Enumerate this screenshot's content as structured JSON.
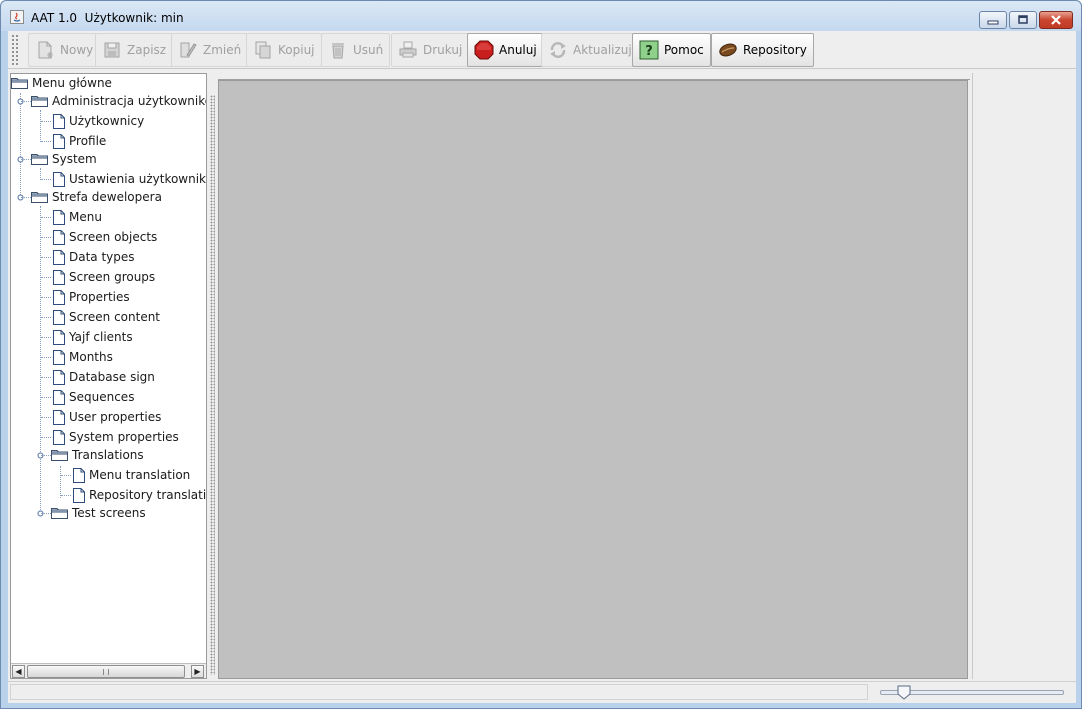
{
  "window": {
    "title": "AAT 1.0  Użytkownik: min",
    "controls": [
      "minimize",
      "maximize",
      "close"
    ]
  },
  "toolbar": {
    "buttons": [
      {
        "label": "Nowy",
        "icon": "new-document-icon",
        "enabled": false
      },
      {
        "label": "Zapisz",
        "icon": "save-floppy-icon",
        "enabled": false
      },
      {
        "label": "Zmień",
        "icon": "edit-pencil-icon",
        "enabled": false
      },
      {
        "label": "Kopiuj",
        "icon": "copy-icon",
        "enabled": false
      },
      {
        "label": "Usuń",
        "icon": "trash-icon",
        "enabled": false
      },
      {
        "label": "Drukuj",
        "icon": "printer-icon",
        "enabled": false
      },
      {
        "label": "Anuluj",
        "icon": "stop-sign-icon",
        "enabled": true
      },
      {
        "label": "Aktualizuj",
        "icon": "refresh-icon",
        "enabled": false
      },
      {
        "label": "Pomoc",
        "icon": "help-question-icon",
        "enabled": true
      },
      {
        "label": "Repository",
        "icon": "repository-bean-icon",
        "enabled": true
      }
    ]
  },
  "tree": {
    "root": "Menu główne",
    "groups": [
      {
        "label": "Administracja użytkowników",
        "items": [
          "Użytkownicy",
          "Profile"
        ]
      },
      {
        "label": "System",
        "items": [
          "Ustawienia użytkownika"
        ]
      },
      {
        "label": "Strefa dewelopera",
        "items": [
          "Menu",
          "Screen objects",
          "Data types",
          "Screen groups",
          "Properties",
          "Screen content",
          "Yajf clients",
          "Months",
          "Database sign",
          "Sequences",
          "User properties",
          "System properties"
        ],
        "subgroups": [
          {
            "label": "Translations",
            "items": [
              "Menu translation",
              "Repository translation"
            ]
          },
          {
            "label": "Test screens",
            "items": []
          }
        ]
      }
    ]
  },
  "statusbar": {
    "text": "",
    "zoom_slider_fraction": 0.1
  },
  "colors": {
    "title_bar": "#c4d8ef",
    "content_area": "#c0c0c0",
    "stop_red": "#c81e1e",
    "tree_line": "#8aa0c0"
  }
}
